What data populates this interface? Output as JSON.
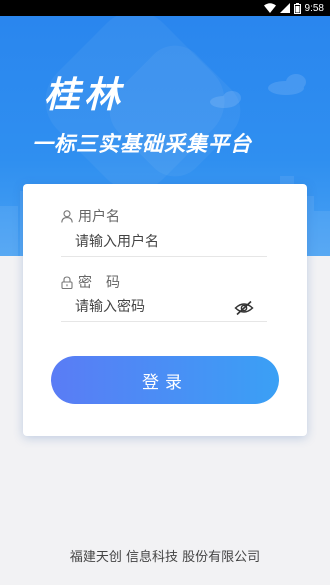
{
  "status_bar": {
    "time": "9:58"
  },
  "brand": {
    "title": "桂林",
    "subtitle": "一标三实基础采集平台"
  },
  "login": {
    "username_label": "用户名",
    "username_placeholder": "请输入用户名",
    "password_label": "密　码",
    "password_placeholder": "请输入密码",
    "submit_label": "登录"
  },
  "footer": {
    "company": "福建天创 信息科技 股份有限公司"
  },
  "colors": {
    "primary": "#2f8ff0",
    "button_start": "#5a7cf5",
    "button_end": "#3aa0f5"
  }
}
